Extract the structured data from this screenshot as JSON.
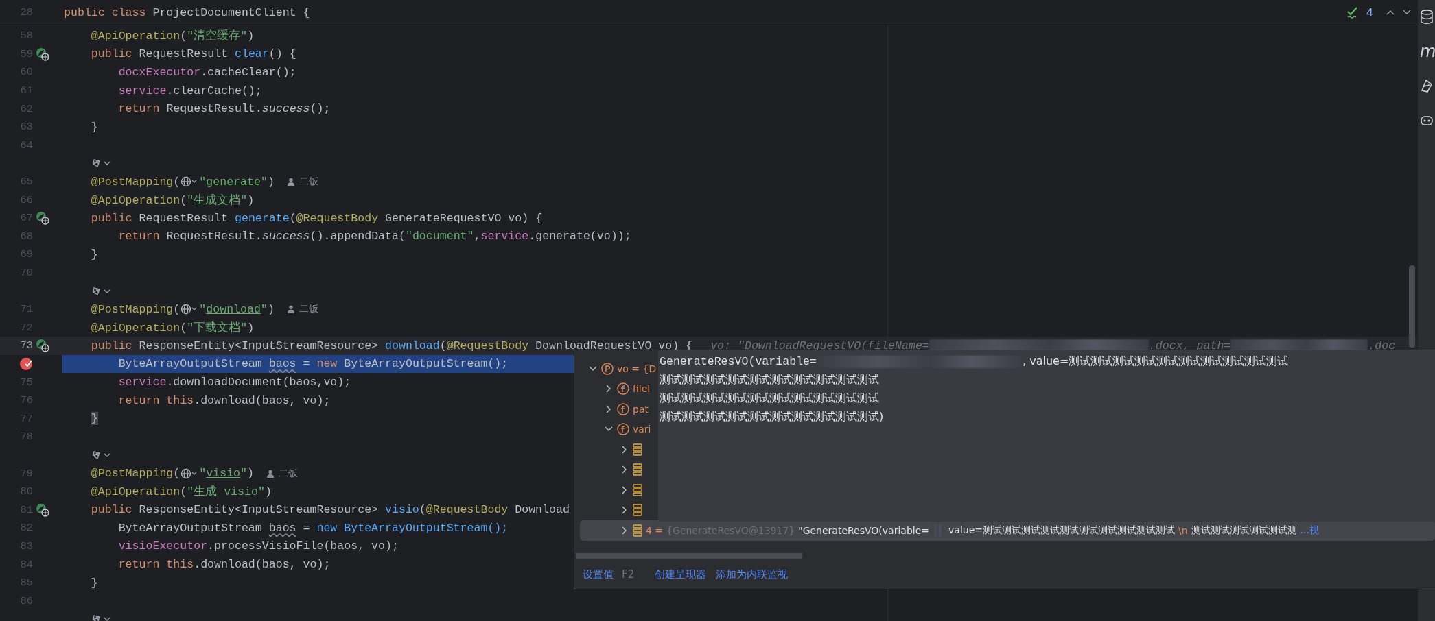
{
  "editor": {
    "sticky_header": {
      "number": "28",
      "tokens": [
        {
          "t": "public class ",
          "kind": "kw"
        },
        {
          "t": "ProjectDocumentClient {",
          "kind": "plain"
        }
      ]
    },
    "inspections": {
      "count": "4"
    },
    "lines": [
      {
        "kind": "code",
        "number": "58",
        "indent": {
          "kind": "member"
        },
        "current": false,
        "highlighted": false,
        "parts": [
          {
            "kind": "code",
            "tokens": [
              {
                "t": "@ApiOperation",
                "kind": "ann"
              },
              {
                "t": "(",
                "kind": "plain"
              },
              {
                "t": "\"清空缓存\"",
                "kind": "str"
              },
              {
                "t": ")",
                "kind": "plain"
              }
            ]
          }
        ]
      },
      {
        "kind": "code",
        "number": "59",
        "gutter": {
          "kind": "endpoint"
        },
        "indent": {
          "kind": "member"
        },
        "current": false,
        "highlighted": false,
        "parts": [
          {
            "kind": "code",
            "tokens": [
              {
                "t": "public ",
                "kind": "kw"
              },
              {
                "t": "RequestResult ",
                "kind": "plain"
              },
              {
                "t": "clear",
                "kind": "fn"
              },
              {
                "t": "() {",
                "kind": "plain"
              }
            ]
          }
        ]
      },
      {
        "kind": "code",
        "number": "60",
        "indent": {
          "kind": "body"
        },
        "current": false,
        "highlighted": false,
        "parts": [
          {
            "kind": "code",
            "tokens": [
              {
                "t": "docxExecutor",
                "kind": "field"
              },
              {
                "t": ".cacheClear();",
                "kind": "plain"
              }
            ]
          }
        ]
      },
      {
        "kind": "code",
        "number": "61",
        "indent": {
          "kind": "body"
        },
        "current": false,
        "highlighted": false,
        "parts": [
          {
            "kind": "code",
            "tokens": [
              {
                "t": "service",
                "kind": "field"
              },
              {
                "t": ".clearCache();",
                "kind": "plain"
              }
            ]
          }
        ]
      },
      {
        "kind": "code",
        "number": "62",
        "indent": {
          "kind": "body"
        },
        "current": false,
        "highlighted": false,
        "parts": [
          {
            "kind": "code",
            "tokens": [
              {
                "t": "return ",
                "kind": "kw"
              },
              {
                "t": "RequestResult.",
                "kind": "plain"
              },
              {
                "t": "success",
                "kind": "italic"
              },
              {
                "t": "();",
                "kind": "plain"
              }
            ]
          }
        ]
      },
      {
        "kind": "code",
        "number": "63",
        "indent": {
          "kind": "member"
        },
        "current": false,
        "highlighted": false,
        "parts": [
          {
            "kind": "code",
            "tokens": [
              {
                "t": "}",
                "kind": "plain"
              }
            ]
          }
        ]
      },
      {
        "kind": "code",
        "number": "64",
        "current": false,
        "highlighted": false
      },
      {
        "kind": "hint"
      },
      {
        "kind": "code",
        "number": "65",
        "indent": {
          "kind": "member"
        },
        "current": false,
        "highlighted": false,
        "parts": [
          {
            "kind": "code",
            "tokens": [
              {
                "t": "@PostMapping",
                "kind": "ann"
              },
              {
                "t": "(",
                "kind": "plain"
              }
            ]
          },
          {
            "kind": "globe"
          },
          {
            "kind": "code",
            "tokens": [
              {
                "t": "\"",
                "kind": "str"
              },
              {
                "t": "generate",
                "kind": "link"
              },
              {
                "t": "\"",
                "kind": "str"
              },
              {
                "t": ")",
                "kind": "plain"
              }
            ]
          },
          {
            "kind": "author",
            "text": "二饭"
          }
        ]
      },
      {
        "kind": "code",
        "number": "66",
        "indent": {
          "kind": "member"
        },
        "current": false,
        "highlighted": false,
        "parts": [
          {
            "kind": "code",
            "tokens": [
              {
                "t": "@ApiOperation",
                "kind": "ann"
              },
              {
                "t": "(",
                "kind": "plain"
              },
              {
                "t": "\"生成文档\"",
                "kind": "str"
              },
              {
                "t": ")",
                "kind": "plain"
              }
            ]
          }
        ]
      },
      {
        "kind": "code",
        "number": "67",
        "gutter": {
          "kind": "endpoint"
        },
        "indent": {
          "kind": "member"
        },
        "current": false,
        "highlighted": false,
        "parts": [
          {
            "kind": "code",
            "tokens": [
              {
                "t": "public ",
                "kind": "kw"
              },
              {
                "t": "RequestResult ",
                "kind": "plain"
              },
              {
                "t": "generate",
                "kind": "fn"
              },
              {
                "t": "(",
                "kind": "plain"
              },
              {
                "t": "@RequestBody ",
                "kind": "ann"
              },
              {
                "t": "GenerateRequestVO vo) {",
                "kind": "plain"
              }
            ]
          }
        ]
      },
      {
        "kind": "code",
        "number": "68",
        "indent": {
          "kind": "body"
        },
        "current": false,
        "highlighted": false,
        "parts": [
          {
            "kind": "code",
            "tokens": [
              {
                "t": "return ",
                "kind": "kw"
              },
              {
                "t": "RequestResult.",
                "kind": "plain"
              },
              {
                "t": "success",
                "kind": "italic"
              },
              {
                "t": "().appendData(",
                "kind": "plain"
              },
              {
                "t": "\"document\"",
                "kind": "str"
              },
              {
                "t": ",",
                "kind": "plain"
              },
              {
                "t": "service",
                "kind": "field"
              },
              {
                "t": ".generate(vo));",
                "kind": "plain"
              }
            ]
          }
        ]
      },
      {
        "kind": "code",
        "number": "69",
        "indent": {
          "kind": "member"
        },
        "current": false,
        "highlighted": false,
        "parts": [
          {
            "kind": "code",
            "tokens": [
              {
                "t": "}",
                "kind": "plain"
              }
            ]
          }
        ]
      },
      {
        "kind": "code",
        "number": "70",
        "current": false,
        "highlighted": false
      },
      {
        "kind": "hint"
      },
      {
        "kind": "code",
        "number": "71",
        "indent": {
          "kind": "member"
        },
        "current": false,
        "highlighted": false,
        "parts": [
          {
            "kind": "code",
            "tokens": [
              {
                "t": "@PostMapping",
                "kind": "ann"
              },
              {
                "t": "(",
                "kind": "plain"
              }
            ]
          },
          {
            "kind": "globe"
          },
          {
            "kind": "code",
            "tokens": [
              {
                "t": "\"",
                "kind": "str"
              },
              {
                "t": "download",
                "kind": "link"
              },
              {
                "t": "\"",
                "kind": "str"
              },
              {
                "t": ")",
                "kind": "plain"
              }
            ]
          },
          {
            "kind": "author",
            "text": "二饭"
          }
        ]
      },
      {
        "kind": "code",
        "number": "72",
        "indent": {
          "kind": "member"
        },
        "current": false,
        "highlighted": false,
        "parts": [
          {
            "kind": "code",
            "tokens": [
              {
                "t": "@ApiOperation",
                "kind": "ann"
              },
              {
                "t": "(",
                "kind": "plain"
              },
              {
                "t": "\"下载文档\"",
                "kind": "str"
              },
              {
                "t": ")",
                "kind": "plain"
              }
            ]
          }
        ]
      },
      {
        "kind": "code",
        "number": "73",
        "gutter": {
          "kind": "endpoint"
        },
        "indent": {
          "kind": "member"
        },
        "current": true,
        "highlighted": false,
        "parts": [
          {
            "kind": "code",
            "tokens": [
              {
                "t": "public ",
                "kind": "kw"
              },
              {
                "t": "ResponseEntity<InputStreamResource> ",
                "kind": "plain"
              },
              {
                "t": "download",
                "kind": "fn"
              },
              {
                "t": "(",
                "kind": "plain"
              },
              {
                "t": "@RequestBody ",
                "kind": "ann"
              },
              {
                "t": "DownloadRequestVO vo) {",
                "kind": "plain"
              }
            ]
          },
          {
            "kind": "inline_value",
            "segments": [
              {
                "kind": "text",
                "t": "vo: \"DownloadRequestVO(fileName="
              },
              {
                "kind": "redacted"
              },
              {
                "kind": "text",
                "t": ".docx, path="
              },
              {
                "kind": "redacted"
              },
              {
                "kind": "text",
                "t": ".doc"
              }
            ]
          }
        ]
      },
      {
        "kind": "code",
        "gutter": {
          "kind": "breakpoint"
        },
        "indent": {
          "kind": "body"
        },
        "current": false,
        "highlighted": true,
        "parts": [
          {
            "kind": "code",
            "tokens": [
              {
                "t": "ByteArrayOutputStream ",
                "kind": "plain"
              },
              {
                "t": "baos",
                "kind": "warn"
              },
              {
                "t": " = ",
                "kind": "plain"
              },
              {
                "t": "new ",
                "kind": "kw"
              },
              {
                "t": "ByteArrayOutputStream();",
                "kind": "plain"
              }
            ]
          }
        ]
      },
      {
        "kind": "code",
        "number": "75",
        "indent": {
          "kind": "body"
        },
        "current": false,
        "highlighted": false,
        "parts": [
          {
            "kind": "code",
            "tokens": [
              {
                "t": "service",
                "kind": "field"
              },
              {
                "t": ".downloadDocument(baos,vo);",
                "kind": "plain"
              }
            ]
          }
        ]
      },
      {
        "kind": "code",
        "number": "76",
        "indent": {
          "kind": "body"
        },
        "current": false,
        "highlighted": false,
        "parts": [
          {
            "kind": "code",
            "tokens": [
              {
                "t": "return this",
                "kind": "kw"
              },
              {
                "t": ".download(baos, vo);",
                "kind": "plain"
              }
            ]
          }
        ]
      },
      {
        "kind": "code",
        "number": "77",
        "indent": {
          "kind": "member"
        },
        "current": false,
        "highlighted": false,
        "parts": [
          {
            "kind": "code",
            "tokens": [
              {
                "t": "}",
                "kind": "brace"
              }
            ]
          }
        ]
      },
      {
        "kind": "code",
        "number": "78",
        "current": false,
        "highlighted": false
      },
      {
        "kind": "hint"
      },
      {
        "kind": "code",
        "number": "79",
        "indent": {
          "kind": "member"
        },
        "current": false,
        "highlighted": false,
        "parts": [
          {
            "kind": "code",
            "tokens": [
              {
                "t": "@PostMapping",
                "kind": "ann"
              },
              {
                "t": "(",
                "kind": "plain"
              }
            ]
          },
          {
            "kind": "globe"
          },
          {
            "kind": "code",
            "tokens": [
              {
                "t": "\"",
                "kind": "str"
              },
              {
                "t": "visio",
                "kind": "link"
              },
              {
                "t": "\"",
                "kind": "str"
              },
              {
                "t": ")",
                "kind": "plain"
              }
            ]
          },
          {
            "kind": "author",
            "text": "二饭"
          }
        ]
      },
      {
        "kind": "code",
        "number": "80",
        "indent": {
          "kind": "member"
        },
        "current": false,
        "highlighted": false,
        "parts": [
          {
            "kind": "code",
            "tokens": [
              {
                "t": "@ApiOperation",
                "kind": "ann"
              },
              {
                "t": "(",
                "kind": "plain"
              },
              {
                "t": "\"生成 visio\"",
                "kind": "str"
              },
              {
                "t": ")",
                "kind": "plain"
              }
            ]
          }
        ]
      },
      {
        "kind": "code",
        "number": "81",
        "gutter": {
          "kind": "endpoint"
        },
        "indent": {
          "kind": "member"
        },
        "current": false,
        "highlighted": false,
        "parts": [
          {
            "kind": "code",
            "tokens": [
              {
                "t": "public ",
                "kind": "kw"
              },
              {
                "t": "ResponseEntity<InputStreamResource> ",
                "kind": "plain"
              },
              {
                "t": "visio",
                "kind": "fn"
              },
              {
                "t": "(",
                "kind": "plain"
              },
              {
                "t": "@RequestBody ",
                "kind": "ann"
              },
              {
                "t": "Download",
                "kind": "plain"
              }
            ]
          }
        ]
      },
      {
        "kind": "code",
        "number": "82",
        "indent": {
          "kind": "body"
        },
        "current": false,
        "highlighted": false,
        "parts": [
          {
            "kind": "code",
            "tokens": [
              {
                "t": "ByteArrayOutputStream ",
                "kind": "plain"
              },
              {
                "t": "baos",
                "kind": "warn"
              },
              {
                "t": " = ",
                "kind": "plain"
              },
              {
                "t": "new ByteArrayOutputStream();",
                "kind": "fn"
              }
            ]
          }
        ]
      },
      {
        "kind": "code",
        "number": "83",
        "indent": {
          "kind": "body"
        },
        "current": false,
        "highlighted": false,
        "parts": [
          {
            "kind": "code",
            "tokens": [
              {
                "t": "visioExecutor",
                "kind": "field"
              },
              {
                "t": ".processVisioFile(baos, vo);",
                "kind": "plain"
              }
            ]
          }
        ]
      },
      {
        "kind": "code",
        "number": "84",
        "indent": {
          "kind": "body"
        },
        "current": false,
        "highlighted": false,
        "parts": [
          {
            "kind": "code",
            "tokens": [
              {
                "t": "return this",
                "kind": "kw"
              },
              {
                "t": ".download(baos, vo);",
                "kind": "plain"
              }
            ]
          }
        ]
      },
      {
        "kind": "code",
        "number": "85",
        "indent": {
          "kind": "member"
        },
        "current": false,
        "highlighted": false,
        "parts": [
          {
            "kind": "code",
            "tokens": [
              {
                "t": "}",
                "kind": "plain"
              }
            ]
          }
        ]
      },
      {
        "kind": "code",
        "number": "86",
        "current": false,
        "highlighted": false
      },
      {
        "kind": "hint"
      }
    ]
  },
  "debug_popup": {
    "tree": [
      {
        "kind": "param",
        "label": "vo = {D",
        "expanded": true,
        "selected": false,
        "children": [
          {
            "kind": "field",
            "label": "filel",
            "expanded": false,
            "selected": false
          },
          {
            "kind": "field",
            "label": "pat",
            "expanded": false,
            "selected": false
          },
          {
            "kind": "field",
            "label": "vari",
            "expanded": true,
            "selected": false,
            "children": [
              {
                "kind": "element",
                "expanded": false,
                "selected": false
              },
              {
                "kind": "element",
                "expanded": false,
                "selected": false
              },
              {
                "kind": "element",
                "expanded": false,
                "selected": false
              },
              {
                "kind": "element",
                "expanded": false,
                "selected": false
              },
              {
                "kind": "element",
                "label": "4 =",
                "type": "{GenerateResVO@13917}",
                "expanded": false,
                "selected": true,
                "segments": [
                  {
                    "kind": "text",
                    "t": "\"GenerateResVO(variable="
                  },
                  {
                    "kind": "redacted"
                  },
                  {
                    "kind": "text",
                    "t": "value=测试测试测试测试测试测试测试测试测试测试"
                  },
                  {
                    "kind": "escape",
                    "t": "\\n"
                  },
                  {
                    "kind": "text",
                    "t": "测试测试测试测试测试测"
                  },
                  {
                    "kind": "more",
                    "t": "...视"
                  }
                ]
              }
            ]
          }
        ]
      }
    ],
    "tooltip": {
      "lines": [
        {
          "segments": [
            {
              "kind": "text",
              "t": "GenerateResVO(variable="
            },
            {
              "kind": "redacted"
            },
            {
              "kind": "text",
              "t": ", value=测试测试测试测试测试测试测试测试测试测试"
            }
          ]
        },
        {
          "segments": [
            {
              "kind": "text",
              "t": "测试测试测试测试测试测试测试测试测试测试"
            }
          ]
        },
        {
          "segments": [
            {
              "kind": "text",
              "t": "测试测试测试测试测试测试测试测试测试测试"
            }
          ]
        },
        {
          "segments": [
            {
              "kind": "text",
              "t": "测试测试测试测试测试测试测试测试测试测试)"
            }
          ]
        }
      ]
    },
    "footer": [
      {
        "label": "设置值",
        "shortcut": "F2"
      },
      {
        "label": "创建呈现器"
      },
      {
        "label": "添加为内联监视"
      }
    ]
  },
  "tool_strip": [
    {
      "kind": "database"
    },
    {
      "kind": "glyph",
      "glyph": "m"
    },
    {
      "kind": "bean"
    },
    {
      "kind": "robot"
    }
  ]
}
